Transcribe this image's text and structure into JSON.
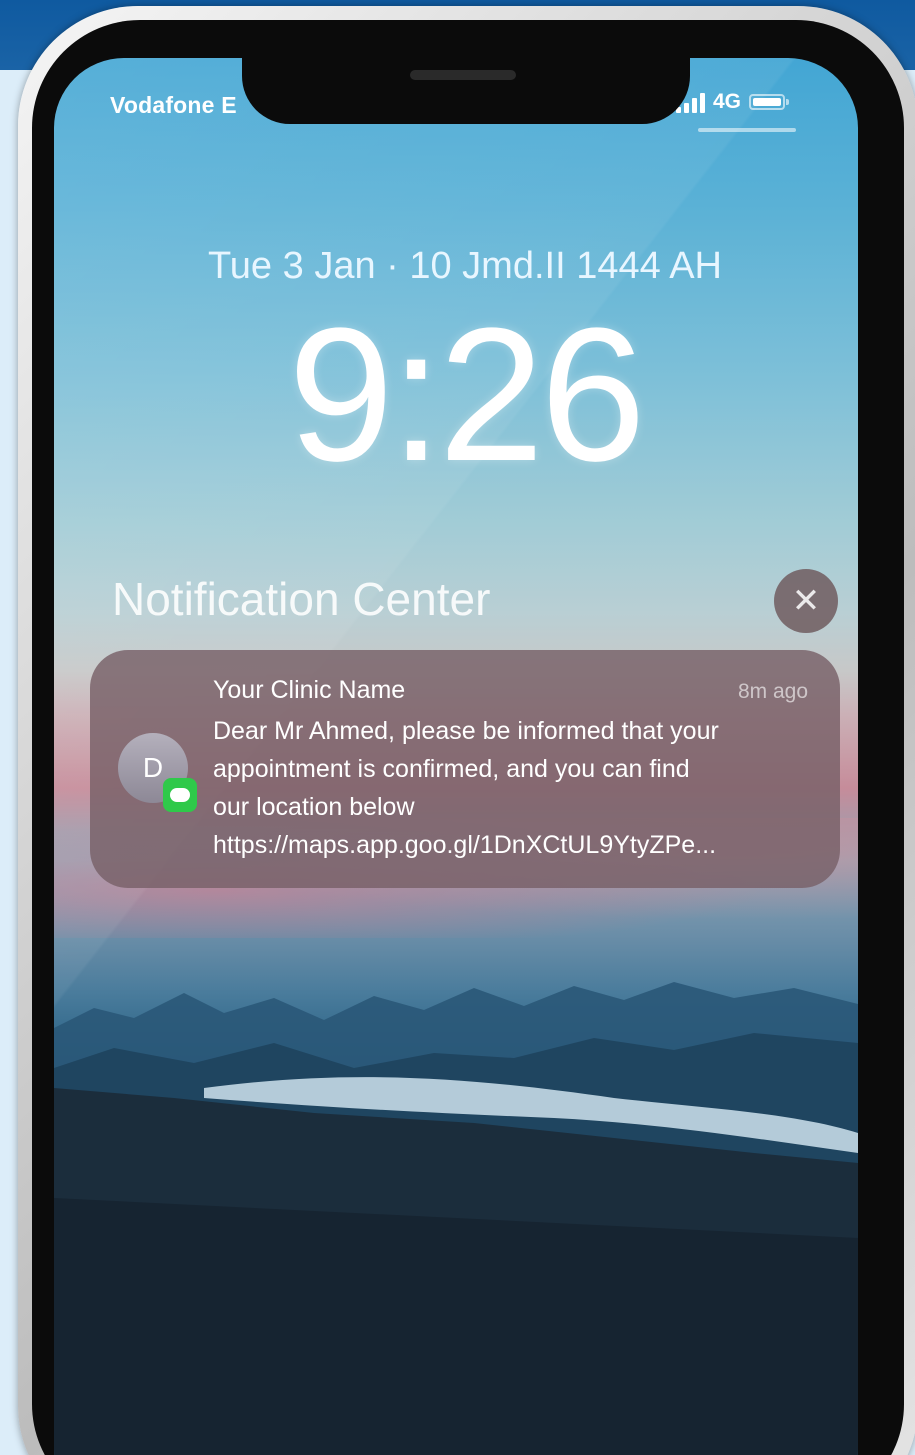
{
  "status_bar": {
    "carrier": "Vodafone E",
    "network": "4G"
  },
  "lock_screen": {
    "date": "Tue 3 Jan · 10 Jmd.II 1444 AH",
    "time": "9:26"
  },
  "notification_center": {
    "title": "Notification Center",
    "close_icon": "close-icon",
    "notification": {
      "avatar_letter": "D",
      "app_icon": "messages-icon",
      "sender": "Your Clinic Name",
      "time_ago": "8m ago",
      "body_lines": [
        "Dear Mr Ahmed, please be informed that your",
        "appointment is confirmed, and you can find",
        "our location below",
        "https://maps.app.goo.gl/1DnXCtUL9YtyZPe..."
      ]
    }
  },
  "colors": {
    "page_top_band": "#0f5aa0",
    "page_background": "#e4f2fb",
    "notification_card": "#786068",
    "messages_badge": "#2fc94a"
  }
}
